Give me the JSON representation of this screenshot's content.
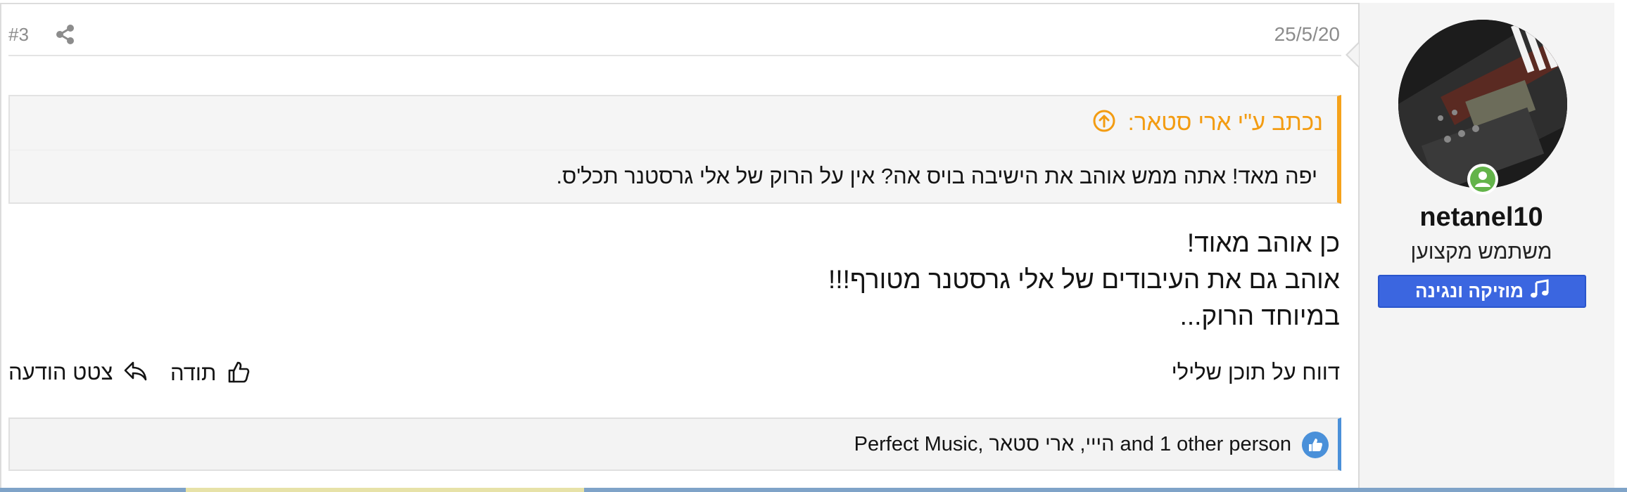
{
  "post": {
    "number": "#3",
    "date": "25/5/20"
  },
  "quote": {
    "author_line": "נכתב ע\"י ארי סטאר:",
    "text": "יפה מאד! אתה ממש אוהב את הישיבה בויס אה? אין על הרוק של אלי גרסטנר תכל'ס."
  },
  "message": {
    "lines": [
      "כן אוהב מאוד!",
      "אוהב גם את העיבודים של אלי גרסטנר מטורף!!!",
      "במיוחד הרוק..."
    ]
  },
  "actions": {
    "report": "דווח על תוכן שלילי",
    "like": "תודה",
    "reply": "צטט הודעה"
  },
  "reactions": {
    "text": "Perfect Music, הייי, ארי סטאר and 1 other person"
  },
  "user": {
    "name": "netanel10",
    "title": "משתמש מקצוען",
    "banner": "מוזיקה ונגינה",
    "online_color": "#63b44a"
  },
  "colors": {
    "quote_accent": "#f39c12",
    "banner_bg": "#3b66e0",
    "likes_accent": "#4a90d9"
  },
  "icons": [
    "share-icon",
    "arrow-up-circle-icon",
    "thumbs-up-icon",
    "reply-icon",
    "music-note-icon",
    "user-icon",
    "like-badge-icon"
  ]
}
